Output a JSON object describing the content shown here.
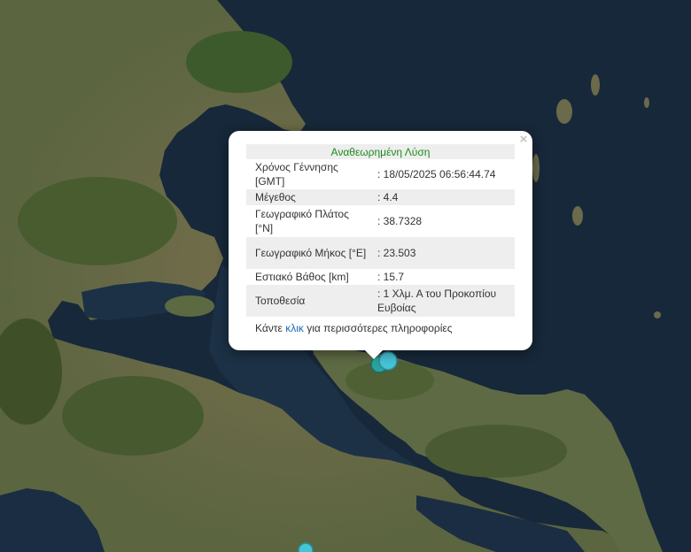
{
  "popup": {
    "title": "Αναθεωρημένη Λύση",
    "rows": [
      {
        "label": "Χρόνος Γέννησης [GMT]",
        "value": ": 18/05/2025 06:56:44.74"
      },
      {
        "label": "Μέγεθος",
        "value": ": 4.4"
      },
      {
        "label": "Γεωγραφικό Πλάτος [°N]",
        "value": ": 38.7328"
      },
      {
        "label": "Γεωγραφικό Μήκος [°E]",
        "value": ": 23.503"
      },
      {
        "label": "Εστιακό Βάθος [km]",
        "value": ": 15.7"
      },
      {
        "label": "Τοποθεσία",
        "value": ": 1 Χλμ. Α του Προκοπίου Ευβοίας"
      }
    ],
    "more_prefix": "Κάντε ",
    "more_link": "κλικ",
    "more_suffix": " για περισσότερες πληροφορίες",
    "close_symbol": "×"
  },
  "colors": {
    "sea": "#17283a",
    "land": "#6b6a4a",
    "forest": "#3d5a2c",
    "marker_fill": "#45c4d6",
    "popup_title": "#1e8a1e",
    "link": "#1a6bb5"
  },
  "icons": {
    "close": "close-icon",
    "marker": "earthquake-marker"
  }
}
